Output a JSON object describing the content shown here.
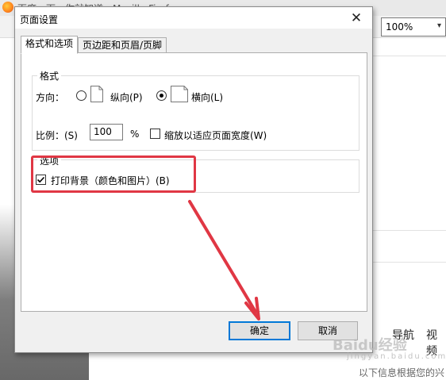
{
  "browser": {
    "window_title": "百度一下，你就知道 - Mozilla Firefox",
    "zoom_select": {
      "value": "100%"
    },
    "page_nav": [
      "导航",
      "视频"
    ],
    "footer_text": "以下信息根据您的兴",
    "watermark": {
      "brand": "Baidu经验",
      "url": "jingyan.baidu.com"
    }
  },
  "dialog": {
    "title": "页面设置",
    "close_glyph": "✕",
    "tabs": [
      {
        "label": "格式和选项",
        "active": true
      },
      {
        "label": "页边距和页眉/页脚",
        "active": false
      }
    ],
    "format_group": {
      "title": "格式",
      "orientation_label": "方向：",
      "portrait_label": "纵向(P)",
      "landscape_label": "横向(L)",
      "selected_orientation": "landscape",
      "scale_label": "比例：(S)",
      "scale_value": "100",
      "scale_unit": "%",
      "shrink_to_fit_label": "缩放以适应页面宽度(W)",
      "shrink_to_fit_checked": false
    },
    "options_group": {
      "title": "选项",
      "print_background_label": "打印背景（颜色和图片）(B)",
      "print_background_checked": true
    },
    "buttons": {
      "ok": "确定",
      "cancel": "取消"
    }
  },
  "annotation": {
    "color": "#e03744"
  },
  "colors": {
    "focus_blue": "#0078d7",
    "dialog_bg": "#f0f0f0"
  }
}
